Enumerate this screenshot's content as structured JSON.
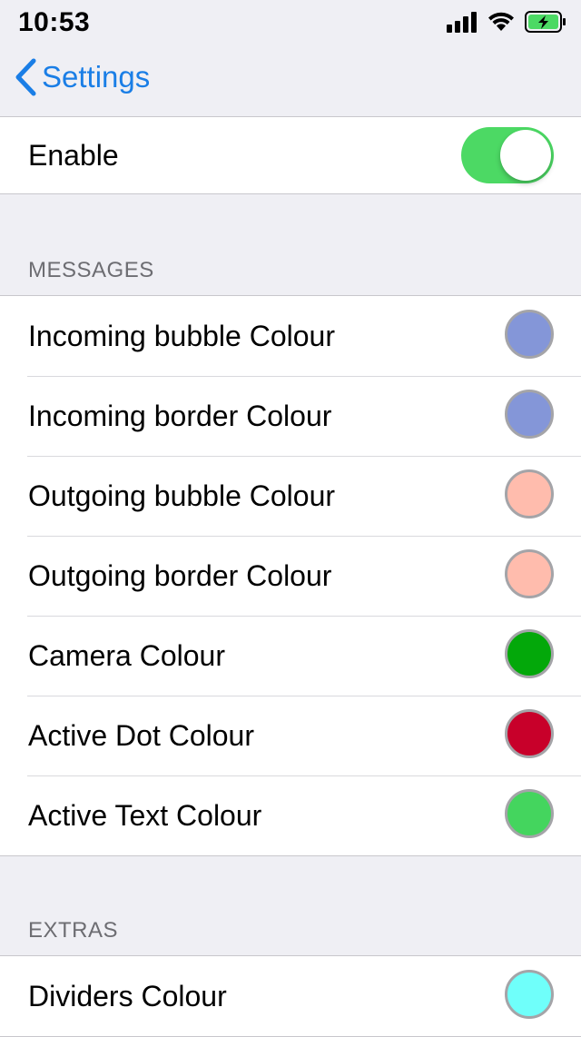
{
  "status_bar": {
    "time": "10:53",
    "icons": [
      "cellular-signal-icon",
      "wifi-icon",
      "battery-charging-icon"
    ],
    "battery_color": "#4cd964"
  },
  "nav": {
    "back_label": "Settings",
    "accent_color": "#1a7ee6"
  },
  "enable": {
    "label": "Enable",
    "toggle_on": true,
    "toggle_color": "#4cd964"
  },
  "messages": {
    "header": "MESSAGES",
    "rows": [
      {
        "label": "Incoming bubble Colour",
        "color": "#8496d8"
      },
      {
        "label": "Incoming border Colour",
        "color": "#8496d8"
      },
      {
        "label": "Outgoing bubble Colour",
        "color": "#ffbcad"
      },
      {
        "label": "Outgoing border Colour",
        "color": "#ffbcad"
      },
      {
        "label": "Camera Colour",
        "color": "#03a80a"
      },
      {
        "label": "Active Dot Colour",
        "color": "#c8002a"
      },
      {
        "label": "Active Text Colour",
        "color": "#44d55e"
      }
    ]
  },
  "extras": {
    "header": "EXTRAS",
    "rows": [
      {
        "label": "Dividers Colour",
        "color": "#6ffffa"
      }
    ]
  }
}
